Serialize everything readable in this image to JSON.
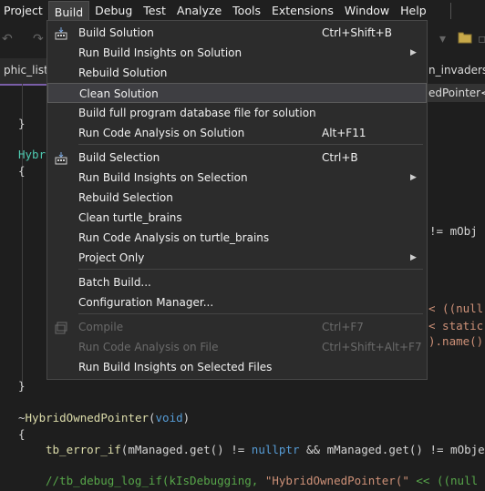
{
  "menubar": {
    "items": [
      "Project",
      "Build",
      "Debug",
      "Test",
      "Analyze",
      "Tools",
      "Extensions",
      "Window",
      "Help"
    ]
  },
  "tabs": {
    "left": "phic_list.hp",
    "right": "n_invaders_s",
    "below": "edPointer<T"
  },
  "build_menu": {
    "items": [
      {
        "label": "Build Solution",
        "shortcut": "Ctrl+Shift+B",
        "icon": "build-icon"
      },
      {
        "label": "Run Build Insights on Solution",
        "submenu": true
      },
      {
        "label": "Rebuild Solution"
      },
      {
        "label": "Clean Solution",
        "highlighted": true
      },
      {
        "label": "Build full program database file for solution"
      },
      {
        "label": "Run Code Analysis on Solution",
        "shortcut": "Alt+F11"
      },
      {
        "label": "Build Selection",
        "shortcut": "Ctrl+B",
        "icon": "build-icon"
      },
      {
        "label": "Run Build Insights on Selection",
        "submenu": true
      },
      {
        "label": "Rebuild Selection"
      },
      {
        "label": "Clean turtle_brains"
      },
      {
        "label": "Run Code Analysis on turtle_brains"
      },
      {
        "label": "Project Only",
        "submenu": true
      },
      {
        "label": "Batch Build..."
      },
      {
        "label": "Configuration Manager..."
      },
      {
        "label": "Compile",
        "shortcut": "Ctrl+F7",
        "disabled": true,
        "icon": "compile-icon"
      },
      {
        "label": "Run Code Analysis on File",
        "shortcut": "Ctrl+Shift+Alt+F7",
        "disabled": true
      },
      {
        "label": "Run Build Insights on Selected Files"
      }
    ]
  },
  "code": {
    "brace_close_1": "}",
    "hybrid_frag": "Hybr",
    "brace_open_1": "{",
    "frag_mobj": "!= mObj",
    "frag_null": "< ((null",
    "frag_static": "< static",
    "frag_name": ").name()",
    "brace_close_2": "}",
    "dtor_tilde": "~",
    "dtor_name": "HybridOwnedPointer",
    "dtor_open": "(",
    "dtor_void": "void",
    "dtor_close": ")",
    "brace_open_2": "{",
    "line_err_fn": "tb_error_if",
    "line_err_a": "(mManaged.get() != ",
    "line_err_null": "nullptr",
    "line_err_b": " && mManaged.get() != mObje",
    "line_dbg_a": "//tb_debug_log_if(kIsDebugging, ",
    "line_dbg_str": "\"HybridOwnedPointer(\"",
    "line_dbg_b": " << ((null"
  }
}
